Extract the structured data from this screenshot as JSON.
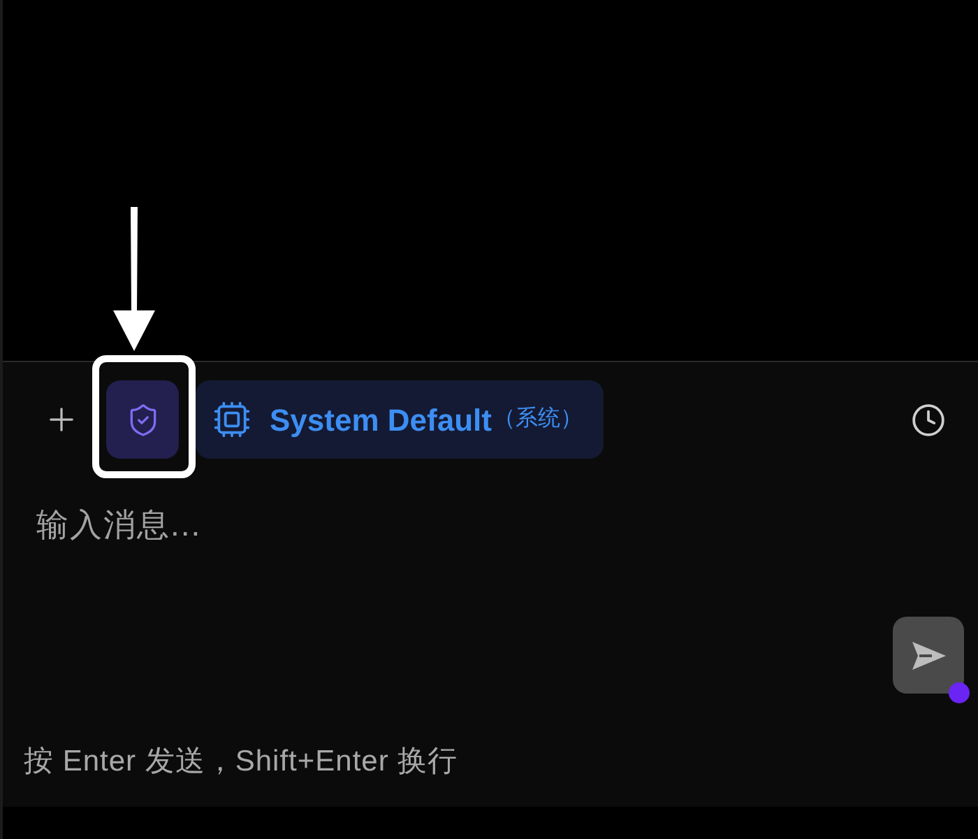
{
  "toolbar": {
    "security_button": {
      "active": true
    },
    "model_chip": {
      "label": "System Default",
      "suffix": "（系统）"
    }
  },
  "composer": {
    "placeholder": "输入消息...",
    "send_button": {
      "disabled": true
    }
  },
  "hint": "按 Enter 发送，Shift+Enter 换行"
}
